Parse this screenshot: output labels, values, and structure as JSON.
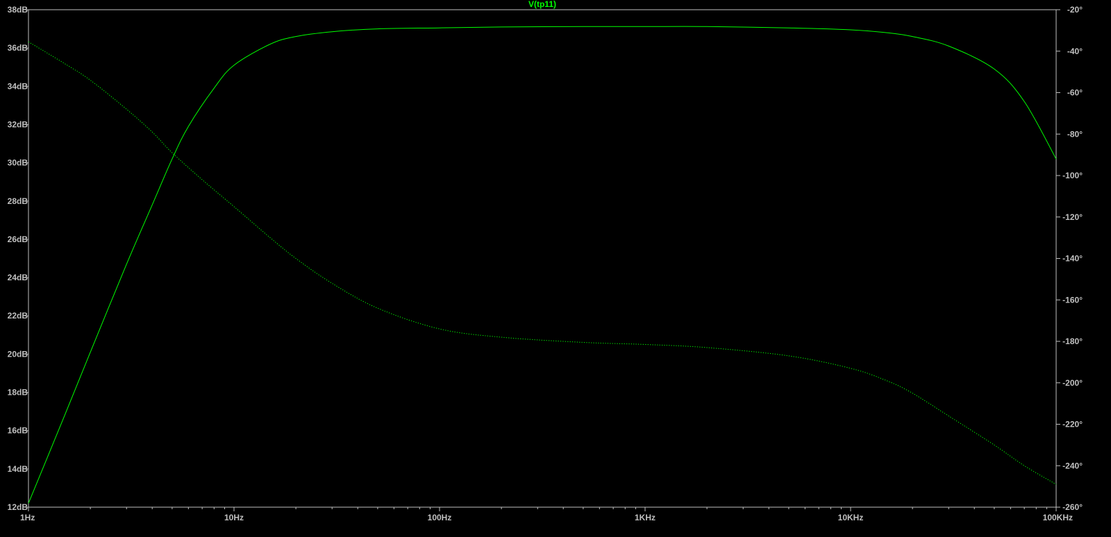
{
  "colors": {
    "background": "#000000",
    "axis": "#c0c0c0",
    "label": "#c0c0c0",
    "trace": "#00ff00"
  },
  "chart_data": {
    "type": "line",
    "title": "V(tp11)",
    "x_scale": "log",
    "xlim": [
      1,
      100000
    ],
    "x_ticks": [
      {
        "value": 1,
        "label": "1Hz"
      },
      {
        "value": 10,
        "label": "10Hz"
      },
      {
        "value": 100,
        "label": "100Hz"
      },
      {
        "value": 1000,
        "label": "1KHz"
      },
      {
        "value": 10000,
        "label": "10KHz"
      },
      {
        "value": 100000,
        "label": "100KHz"
      }
    ],
    "ylim_left": [
      12,
      38
    ],
    "y_ticks_left": [
      "12dB",
      "14dB",
      "16dB",
      "18dB",
      "20dB",
      "22dB",
      "24dB",
      "26dB",
      "28dB",
      "30dB",
      "32dB",
      "34dB",
      "36dB",
      "38dB"
    ],
    "ylim_right": [
      -260,
      -20
    ],
    "y_ticks_right": [
      "-20°",
      "-40°",
      "-60°",
      "-80°",
      "-100°",
      "-120°",
      "-140°",
      "-160°",
      "-180°",
      "-200°",
      "-220°",
      "-240°",
      "-260°"
    ],
    "grid": false,
    "series": [
      {
        "axis": "left",
        "style": "solid",
        "x": [
          1,
          1.5,
          2,
          3,
          4,
          5,
          6,
          8,
          10,
          15,
          20,
          30,
          50,
          100,
          200,
          500,
          1000,
          2000,
          5000,
          10000,
          15000,
          20000,
          30000,
          50000,
          70000,
          100000
        ],
        "y": [
          12.2,
          16.8,
          20.1,
          24.7,
          27.8,
          30.2,
          31.9,
          33.9,
          35.1,
          36.2,
          36.6,
          36.85,
          37.0,
          37.05,
          37.1,
          37.12,
          37.12,
          37.12,
          37.05,
          36.95,
          36.8,
          36.6,
          36.1,
          34.9,
          33.2,
          30.2
        ]
      },
      {
        "axis": "right",
        "style": "dotted",
        "x": [
          1,
          1.5,
          2,
          3,
          4,
          5,
          7,
          10,
          15,
          20,
          30,
          50,
          100,
          200,
          500,
          1000,
          2000,
          5000,
          10000,
          15000,
          20000,
          30000,
          50000,
          70000,
          100000
        ],
        "y": [
          -35.5,
          -46,
          -54,
          -68,
          -79,
          -89,
          -102,
          -115,
          -130,
          -140,
          -152,
          -164,
          -174,
          -178,
          -180.5,
          -181.5,
          -183,
          -187,
          -193,
          -199,
          -205,
          -216,
          -230,
          -240,
          -249
        ]
      }
    ]
  }
}
